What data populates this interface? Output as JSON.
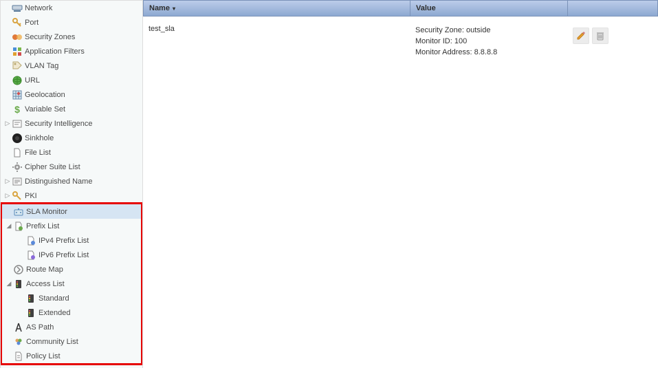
{
  "sidebar": {
    "items": [
      {
        "label": "Network",
        "icon": "network-icon"
      },
      {
        "label": "Port",
        "icon": "key-icon"
      },
      {
        "label": "Security Zones",
        "icon": "zones-icon"
      },
      {
        "label": "Application Filters",
        "icon": "appfilter-icon"
      },
      {
        "label": "VLAN Tag",
        "icon": "tag-icon"
      },
      {
        "label": "URL",
        "icon": "url-icon"
      },
      {
        "label": "Geolocation",
        "icon": "geo-icon"
      },
      {
        "label": "Variable Set",
        "icon": "dollar-icon"
      },
      {
        "label": "Security Intelligence",
        "icon": "intel-icon",
        "expandable": true
      },
      {
        "label": "Sinkhole",
        "icon": "sinkhole-icon"
      },
      {
        "label": "File List",
        "icon": "file-icon"
      },
      {
        "label": "Cipher Suite List",
        "icon": "gear-icon"
      },
      {
        "label": "Distinguished Name",
        "icon": "dn-icon",
        "expandable": true
      },
      {
        "label": "PKI",
        "icon": "key2-icon",
        "expandable": true
      }
    ],
    "highlighted": [
      {
        "label": "SLA Monitor",
        "icon": "sla-icon",
        "selected": true
      },
      {
        "label": "Prefix List",
        "icon": "prefix-icon",
        "expandable": true,
        "expanded": true
      },
      {
        "label": "IPv4 Prefix List",
        "icon": "prefix4-icon",
        "depth": 1
      },
      {
        "label": "IPv6 Prefix List",
        "icon": "prefix6-icon",
        "depth": 1
      },
      {
        "label": "Route Map",
        "icon": "routemap-icon"
      },
      {
        "label": "Access List",
        "icon": "acl-icon",
        "expandable": true,
        "expanded": true
      },
      {
        "label": "Standard",
        "icon": "acl-std-icon",
        "depth": 1
      },
      {
        "label": "Extended",
        "icon": "acl-ext-icon",
        "depth": 1
      },
      {
        "label": "AS Path",
        "icon": "aspath-icon"
      },
      {
        "label": "Community List",
        "icon": "community-icon"
      },
      {
        "label": "Policy List",
        "icon": "policy-icon"
      }
    ]
  },
  "table": {
    "columns": {
      "name": "Name",
      "value": "Value"
    },
    "rows": [
      {
        "name": "test_sla",
        "value_lines": [
          "Security Zone: outside",
          "Monitor ID: 100",
          "Monitor Address: 8.8.8.8"
        ]
      }
    ]
  }
}
